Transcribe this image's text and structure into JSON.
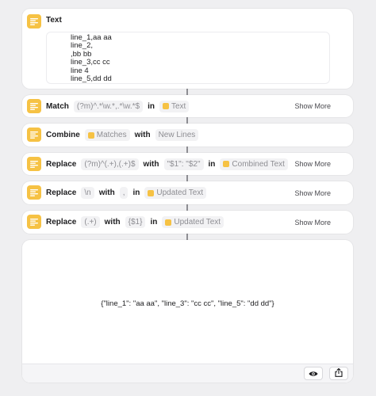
{
  "text_action": {
    "title": "Text",
    "lines": [
      "line_1,aa aa",
      "line_2,",
      ",bb bb",
      "line_3,cc cc",
      "line 4",
      "line_5,dd dd"
    ]
  },
  "match_action": {
    "keyword": "Match",
    "pattern": "(?m)^.*\\w.*,.*\\w.*$",
    "in_label": "in",
    "variable": "Text",
    "show_more": "Show More"
  },
  "combine_action": {
    "keyword": "Combine",
    "variable": "Matches",
    "with_label": "with",
    "separator": "New Lines"
  },
  "replace1_action": {
    "keyword": "Replace",
    "pattern": "(?m)^(.+),(.+)$",
    "with_label": "with",
    "replacement": "\"$1\": \"$2\"",
    "in_label": "in",
    "variable": "Combined Text",
    "show_more": "Show More"
  },
  "replace2_action": {
    "keyword": "Replace",
    "pattern": "\\n",
    "with_label": "with",
    "replacement": ",",
    "in_label": "in",
    "variable": "Updated Text",
    "show_more": "Show More"
  },
  "replace3_action": {
    "keyword": "Replace",
    "pattern": "(.+)",
    "with_label": "with",
    "replacement": "{$1}",
    "in_label": "in",
    "variable": "Updated Text",
    "show_more": "Show More"
  },
  "output": {
    "result": "{\"line_1\": \"aa aa\", \"line_3\": \"cc cc\", \"line_5\": \"dd dd\"}"
  },
  "icons": {
    "action": "text-lines-icon",
    "preview": "eye-icon",
    "share": "share-icon"
  },
  "colors": {
    "accent": "#f6c244",
    "background": "#efeff1",
    "card": "#ffffff",
    "muted": "#8e8e93"
  }
}
